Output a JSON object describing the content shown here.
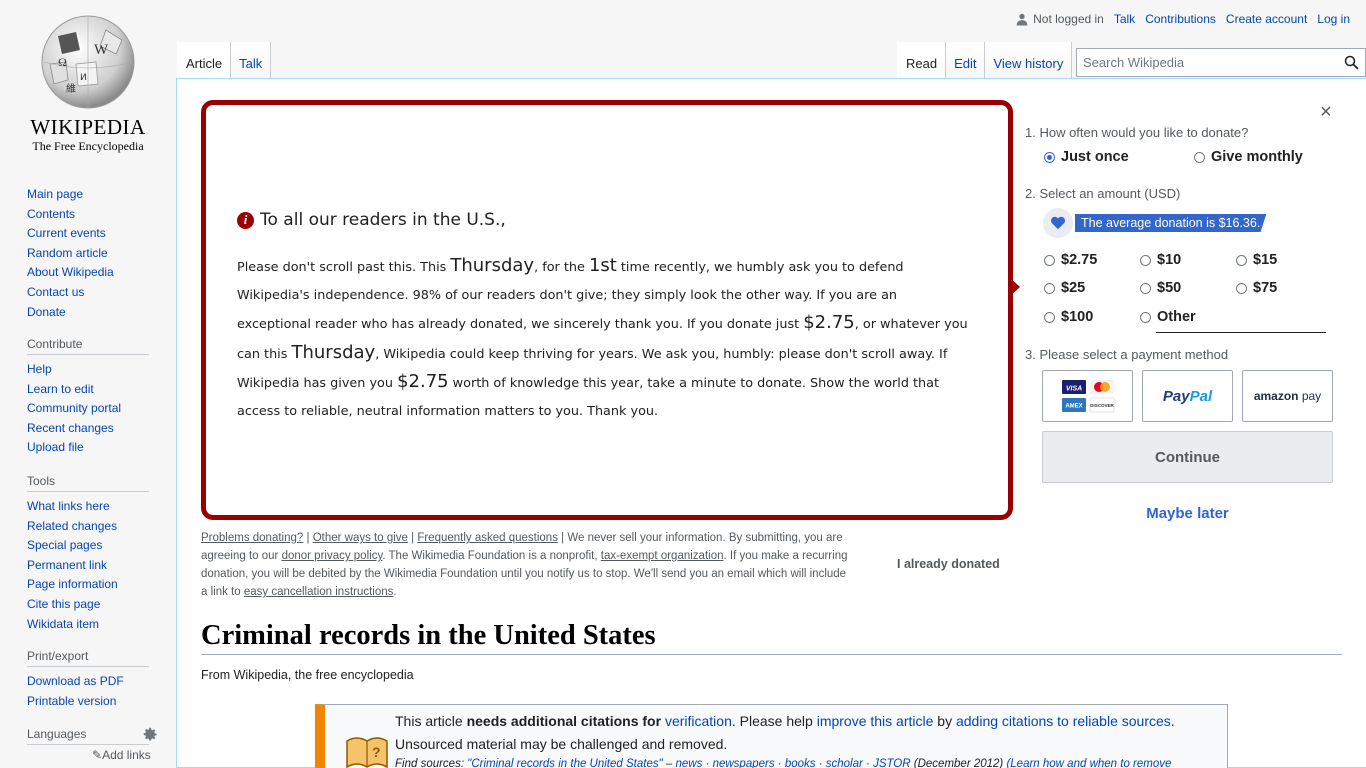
{
  "logo": {
    "wordmark": "WIKIPEDIA",
    "tagline": "The Free Encyclopedia"
  },
  "personal": {
    "not_logged_in": "Not logged in",
    "talk": "Talk",
    "contributions": "Contributions",
    "create_account": "Create account",
    "log_in": "Log in"
  },
  "tabs": {
    "article": "Article",
    "talk": "Talk",
    "read": "Read",
    "edit": "Edit",
    "view_history": "View history"
  },
  "search": {
    "placeholder": "Search Wikipedia"
  },
  "sidebar": {
    "navigation": [
      "Main page",
      "Contents",
      "Current events",
      "Random article",
      "About Wikipedia",
      "Contact us",
      "Donate"
    ],
    "contribute": {
      "heading": "Contribute",
      "items": [
        "Help",
        "Learn to edit",
        "Community portal",
        "Recent changes",
        "Upload file"
      ]
    },
    "tools": {
      "heading": "Tools",
      "items": [
        "What links here",
        "Related changes",
        "Special pages",
        "Permanent link",
        "Page information",
        "Cite this page",
        "Wikidata item"
      ]
    },
    "print": {
      "heading": "Print/export",
      "items": [
        "Download as PDF",
        "Printable version"
      ]
    },
    "languages": {
      "heading": "Languages",
      "add_links": "Add links"
    }
  },
  "banner": {
    "heading": "To all our readers in the U.S.,",
    "p1": "Please don't scroll past this. This ",
    "day1": "Thursday",
    "p2": ", for the ",
    "ordinal": "1st",
    "p3": " time recently, we humbly ask you to defend Wikipedia's independence. 98% of our readers don't give; they simply look the other way. If you are an exceptional reader who has already donated, we sincerely thank you. If you donate just ",
    "amount1": "$2.75",
    "p4": ", or whatever you can this ",
    "day2": "Thursday",
    "p5": ", Wikipedia could keep thriving for years. We ask you, humbly: please don't scroll away. If Wikipedia has given you ",
    "amount2": "$2.75",
    "p6": " worth of knowledge this year, take a minute to donate. Show the world that access to reliable, neutral information matters to you. Thank you.",
    "fine_print": {
      "problems": "Problems donating?",
      "other_ways": "Other ways to give",
      "faq": "Frequently asked questions",
      "t1": " We never sell your information. By submitting, you are agreeing to our ",
      "privacy": "donor privacy policy",
      "t2": ". The Wikimedia Foundation is a nonprofit, ",
      "tax": "tax-exempt organization",
      "t3": ". If you make a recurring donation, you will be debited by the Wikimedia Foundation until you notify us to stop. We'll send you an email which will include a link to ",
      "cancel": "easy cancellation instructions",
      "t4": "."
    },
    "already_donated": "I already donated"
  },
  "donation_form": {
    "close": "×",
    "step1": "1.  How often would you like to donate?",
    "frequency": {
      "once": "Just once",
      "monthly": "Give monthly",
      "selected": "once"
    },
    "step2": "2.  Select an amount (USD)",
    "average_badge": "The average donation is $16.36.",
    "amounts": [
      "$2.75",
      "$10",
      "$15",
      "$25",
      "$50",
      "$75",
      "$100",
      "Other"
    ],
    "step3": "3.  Please select a payment method",
    "payment_methods": {
      "card": "VISA MC AMEX DISCOVER",
      "paypal": "PayPal",
      "amazon": "amazon pay"
    },
    "continue": "Continue",
    "maybe_later": "Maybe later"
  },
  "article": {
    "title": "Criminal records in the United States",
    "subtitle": "From Wikipedia, the free encyclopedia",
    "notice": {
      "a": "This article ",
      "b": "needs additional citations for ",
      "c": "verification",
      "d": ". Please help ",
      "e": "improve this article",
      "f": " by ",
      "g": "adding citations to reliable sources",
      "h": ".",
      "line2": "Unsourced material may be challenged and removed.",
      "find_label": "Find sources: ",
      "find_query": "\"Criminal records in the United States\"",
      "find_sep1": " – ",
      "find_news": "news",
      "find_newspapers": "newspapers",
      "find_books": "books",
      "find_scholar": "scholar",
      "find_jstor": "JSTOR",
      "find_date": "(December 2012)",
      "find_learn": "(Learn how and when to remove"
    }
  }
}
